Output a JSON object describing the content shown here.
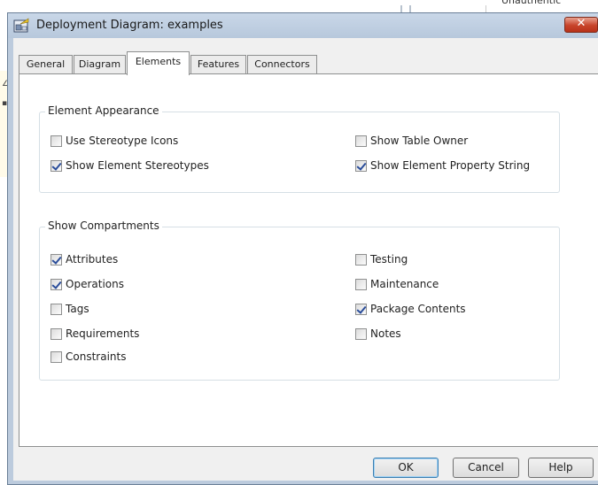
{
  "background": {
    "top_right_text": "Unauthentic"
  },
  "dialog": {
    "title": "Deployment Diagram: examples",
    "close_label": "✕"
  },
  "tabs": [
    {
      "label": "General",
      "active": false
    },
    {
      "label": "Diagram",
      "active": false
    },
    {
      "label": "Elements",
      "active": true
    },
    {
      "label": "Features",
      "active": false
    },
    {
      "label": "Connectors",
      "active": false
    }
  ],
  "element_appearance": {
    "legend": "Element Appearance",
    "options": [
      {
        "label": "Use Stereotype Icons",
        "checked": false
      },
      {
        "label": "Show Element Stereotypes",
        "checked": true
      },
      {
        "label": "Show Table Owner",
        "checked": false
      },
      {
        "label": "Show Element Property String",
        "checked": true
      }
    ]
  },
  "show_compartments": {
    "legend": "Show Compartments",
    "options": [
      {
        "label": "Attributes",
        "checked": true
      },
      {
        "label": "Operations",
        "checked": true
      },
      {
        "label": "Tags",
        "checked": false
      },
      {
        "label": "Requirements",
        "checked": false
      },
      {
        "label": "Constraints",
        "checked": false
      },
      {
        "label": "Testing",
        "checked": false
      },
      {
        "label": "Maintenance",
        "checked": false
      },
      {
        "label": "Package Contents",
        "checked": true
      },
      {
        "label": "Notes",
        "checked": false
      }
    ]
  },
  "buttons": {
    "ok": "OK",
    "cancel": "Cancel",
    "help": "Help"
  }
}
